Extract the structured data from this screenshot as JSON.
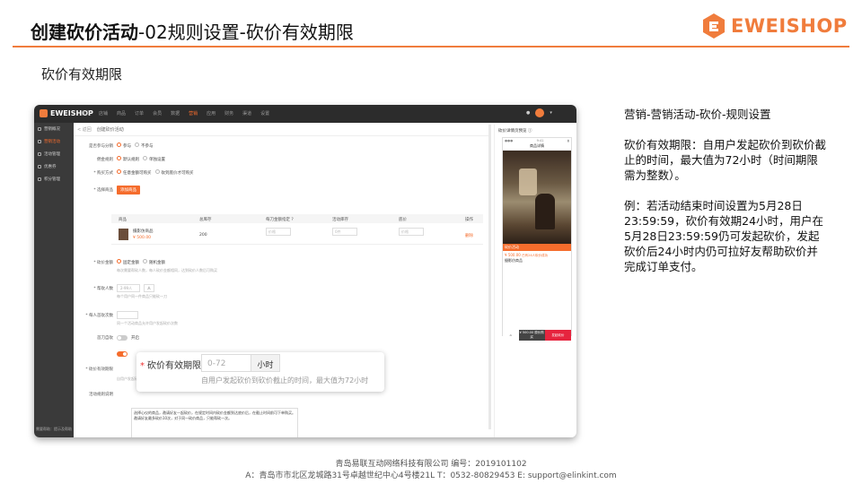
{
  "header": {
    "title_bold": "创建砍价活动",
    "title_rest": "-02规则设置-砍价有效期限",
    "logo_text": "EWEISHOP",
    "accent": "#f07c3c"
  },
  "subheading": "砍价有效期限",
  "screenshot": {
    "topbar": {
      "brand": "EWEISHOP",
      "nav": [
        "首页",
        "店铺",
        "商品",
        "订单",
        "会员",
        "数据",
        "营销",
        "应用",
        "财务",
        "渠道",
        "设置"
      ],
      "active_nav": "营销"
    },
    "sidebar": {
      "items": [
        {
          "label": "营销概况",
          "active": false
        },
        {
          "label": "营销活动",
          "active": true
        },
        {
          "label": "活动管理",
          "active": false
        },
        {
          "label": "优惠券",
          "active": false
        },
        {
          "label": "积分管理",
          "active": false
        }
      ],
      "footer": "需要帮助：提示及帮助"
    },
    "breadcrumb": {
      "back": "< 返回",
      "current": "创建砍价活动"
    },
    "form": {
      "rows": [
        {
          "label": "是否参与分销",
          "opt1": "参与",
          "opt2": "不参与"
        },
        {
          "label": "佣金规则",
          "opt1": "默认规则",
          "opt2": "单独设置"
        },
        {
          "label": "* 购买方式",
          "opt1": "任意金额可购买",
          "opt2": "砍到底价才可购买"
        }
      ],
      "select_goods_label": "* 选择商品",
      "add_goods_btn": "添加商品",
      "table": {
        "headers": [
          "商品",
          "总库存",
          "每刀金额指定 ?",
          "活动库存",
          "底价",
          "操作"
        ],
        "row": {
          "name": "摄影仿商品",
          "price": "¥ 500.00",
          "stock": "200",
          "amount_ph": "价格",
          "stock_ph": "0件",
          "base_ph": "价格",
          "op": "删除"
        }
      },
      "bargain_mode_label": "* 砍价金额",
      "bargain_mode_opt1": "固定金额",
      "bargain_mode_opt2": "随机金额",
      "bargain_mode_hint": "每次需要帮砍人数，每人砍价金额相同，达到砍价人数后可购买",
      "helpers_label": "* 帮砍人数",
      "helpers_ph": "2-99人",
      "helpers_unit": "人",
      "helpers_hint": "每个用户同一件商品只能砍一刀",
      "first_limit_label": "* 每人首砍次数",
      "first_limit_hint": "同一个活动商品允许用户发起砍价次数",
      "self_label": "首刀自砍",
      "self_toggle": "开启",
      "period_label": "* 砍价有效期限",
      "period_hint": "自用户发起砍价到砍价截止的时间",
      "desc_label": "活动规则说明",
      "desc_text": "选择心仪的商品，邀请好友一起砍价，在规定时间内砍价金额到达底价后，在截止时间前可下单购买。",
      "desc_text2": "邀请好友最多砍价10次，对于同一砍价商品，只能帮砍一次。"
    },
    "preview": {
      "title": "砍价详情页预览 ⓘ",
      "status_time": "9:41",
      "nav_title": "商品详情",
      "tag": "砍价活动",
      "price": "¥ 500.00",
      "base": "已有24人砍价成功",
      "name": "摄影仿商品",
      "bottom_left": "¥ 500.00 原价购买",
      "bottom_right": "发起砍价"
    },
    "popup": {
      "label": "砍价有效期限",
      "placeholder": "0-72",
      "unit": "小时",
      "hint": "自用户发起砍价到砍价截止的时间，最大值为72小时"
    }
  },
  "notes": {
    "path": "营销-营销活动-砍价-规则设置",
    "definition": "砍价有效期限：自用户发起砍价到砍价截止的时间，最大值为72小时（时间期限需为整数）。",
    "example": "例：若活动结束时间设置为5月28日23:59:59，砍价有效期24小时，用户在5月28日23:59:59仍可发起砍价，发起砍价后24小时内仍可拉好友帮助砍价并完成订单支付。"
  },
  "footer": {
    "line1": "青岛易联互动网络科技有限公司    编号：2019101102",
    "line2": "A：青岛市市北区龙城路31号卓越世纪中心4号楼21L    T：0532-80829453    E: support@elinkint.com"
  }
}
